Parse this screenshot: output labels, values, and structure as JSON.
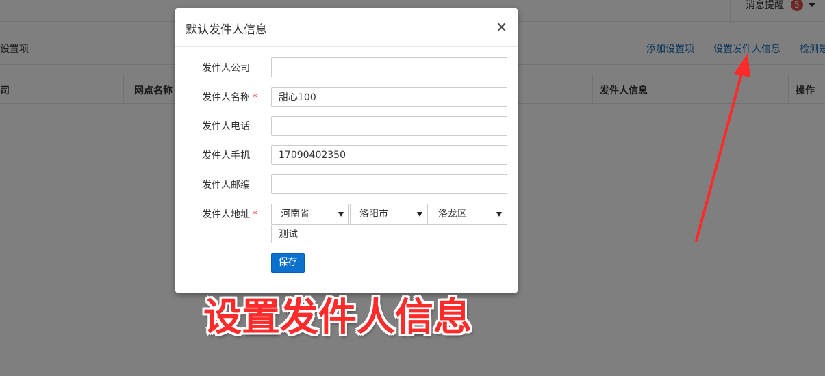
{
  "topbar": {
    "msg_label": "消息提醒",
    "msg_count": "5"
  },
  "subbar": {
    "title": "设置项",
    "links": [
      "添加设置项",
      "设置发件人信息",
      "检测是"
    ]
  },
  "table": {
    "headers": [
      "司",
      "网点名称",
      "发件人信息",
      "操作"
    ]
  },
  "modal": {
    "title": "默认发件人信息",
    "close": "×",
    "fields": [
      {
        "label": "发件人公司",
        "value": "",
        "required": false
      },
      {
        "label": "发件人名称",
        "value": "甜心100",
        "required": true
      },
      {
        "label": "发件人电话",
        "value": "",
        "required": false
      },
      {
        "label": "发件人手机",
        "value": "17090402350",
        "required": false
      },
      {
        "label": "发件人邮编",
        "value": "",
        "required": false
      }
    ],
    "address": {
      "label": "发件人地址",
      "required": true,
      "province": "河南省",
      "city": "洛阳市",
      "district": "洛龙区",
      "detail": "测试"
    },
    "required_mark": "*",
    "save_label": "保存"
  },
  "annotation": {
    "text": "设置发件人信息",
    "color": "#ff2a2a"
  },
  "colors": {
    "link": "#1a6fb8",
    "primary_button": "#0c70cf",
    "badge": "#d9534f",
    "required": "#e23"
  }
}
